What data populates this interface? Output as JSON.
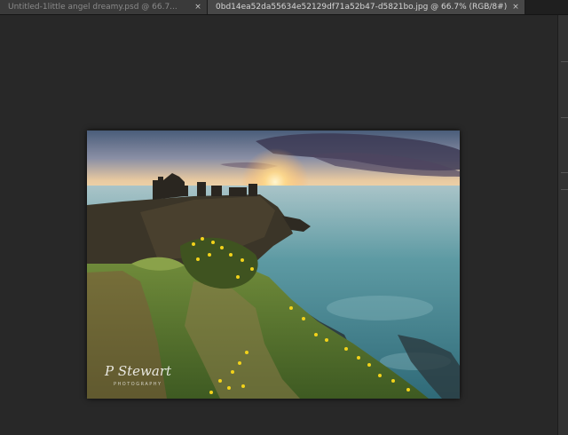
{
  "tabs": [
    {
      "label": "Untitled-1little angel dreamy.psd @ 66.7...",
      "close": "×",
      "active": false
    },
    {
      "label": "0bd14ea52da55634e52129df71a52b47-d5821bo.jpg @ 66.7% (RGB/8#)",
      "close": "×",
      "active": true
    }
  ],
  "photo": {
    "signature": "P Stewart",
    "signature_sub": "PHOTOGRAPHY"
  }
}
